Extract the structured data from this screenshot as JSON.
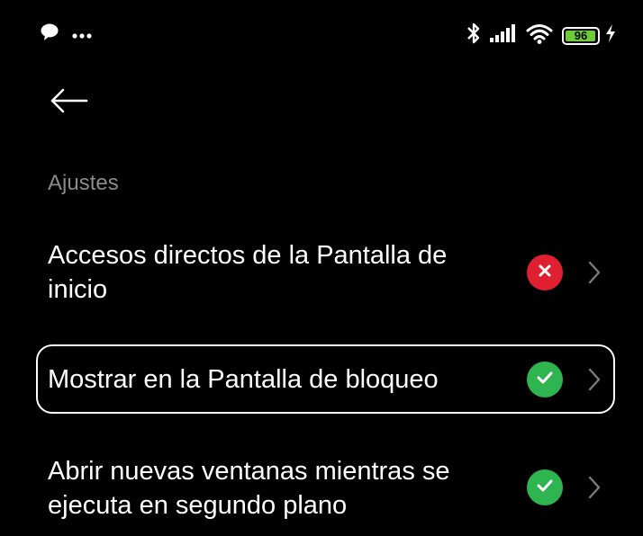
{
  "status_bar": {
    "left_icons": [
      "chat-bubble-icon",
      "more-dots-icon"
    ],
    "right_icons": [
      "bluetooth-icon",
      "signal-icon",
      "wifi-icon",
      "battery-icon",
      "charging-bolt-icon"
    ],
    "battery_level": "96",
    "battery_percent": 96,
    "battery_color": "#6ecc38"
  },
  "header": {
    "back_icon": "arrow-left-icon"
  },
  "section": {
    "label": "Ajustes"
  },
  "settings": [
    {
      "label": "Accesos directos de la Pantalla de inicio",
      "status": "disabled",
      "status_icon": "x-icon",
      "status_color": "#e02030"
    },
    {
      "label": "Mostrar en la Pantalla de bloqueo",
      "status": "enabled",
      "status_icon": "check-icon",
      "status_color": "#2fb54f",
      "highlighted": true
    },
    {
      "label": "Abrir nuevas ventanas mientras se ejecuta en segundo plano",
      "status": "enabled",
      "status_icon": "check-icon",
      "status_color": "#2fb54f"
    }
  ]
}
